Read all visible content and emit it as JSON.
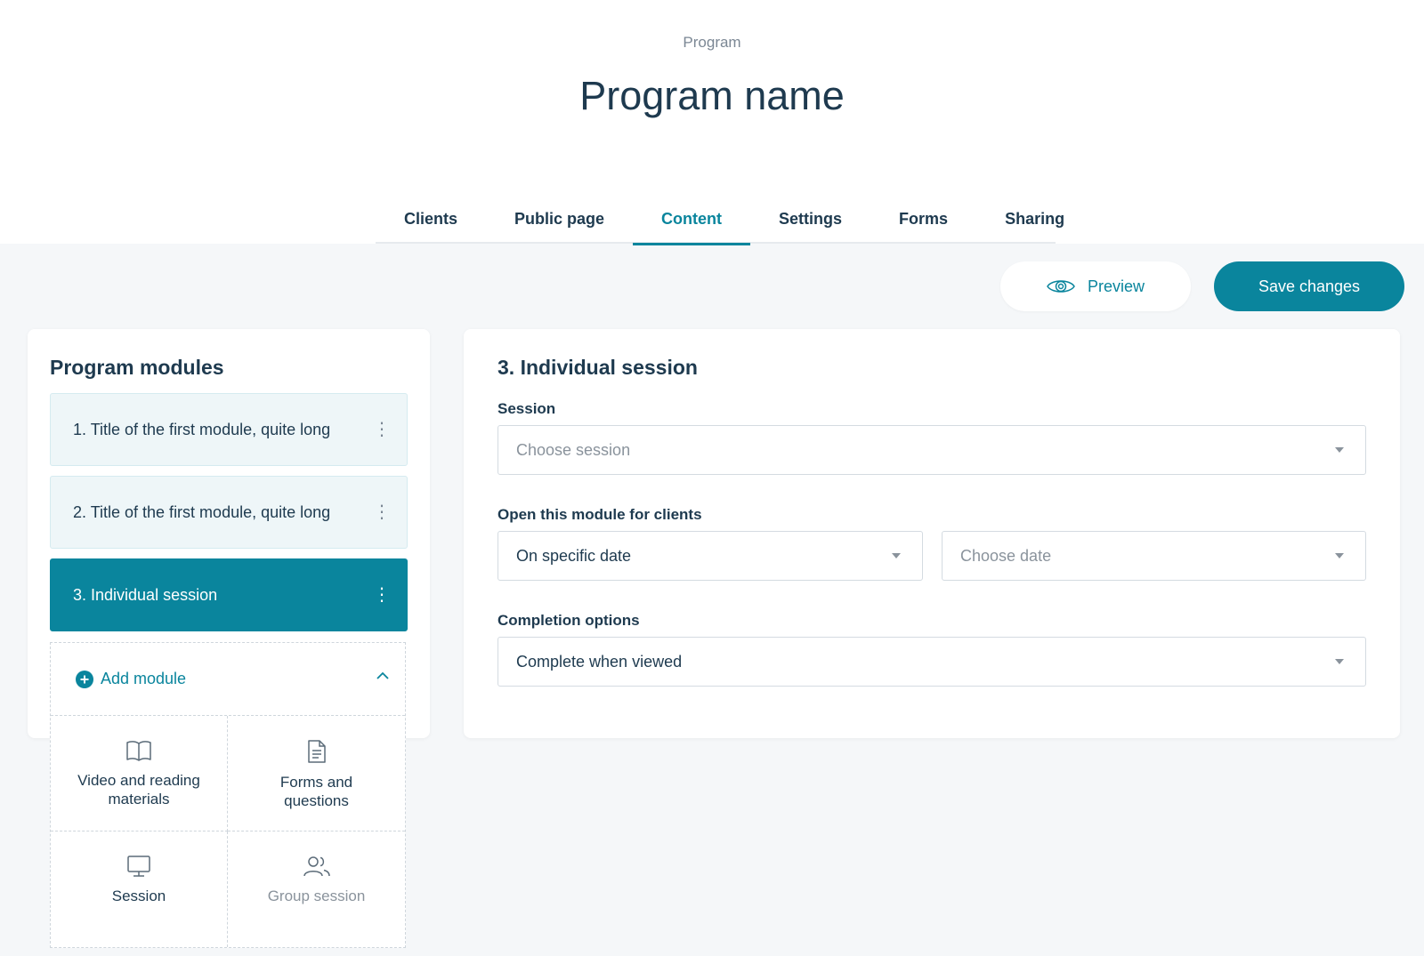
{
  "header": {
    "overline": "Program",
    "title": "Program name"
  },
  "tabs": [
    {
      "label": "Clients",
      "active": false
    },
    {
      "label": "Public page",
      "active": false
    },
    {
      "label": "Content",
      "active": true
    },
    {
      "label": "Settings",
      "active": false
    },
    {
      "label": "Forms",
      "active": false
    },
    {
      "label": "Sharing",
      "active": false
    }
  ],
  "toolbar": {
    "preview_label": "Preview",
    "save_label": "Save changes"
  },
  "modules_panel": {
    "title": "Program modules",
    "items": [
      {
        "label": "1. Title of the first module, quite long",
        "active": false
      },
      {
        "label": "2. Title of the first module, quite long",
        "active": false
      },
      {
        "label": "3. Individual session",
        "active": true
      }
    ],
    "add_module": {
      "label": "Add module",
      "options": [
        {
          "label": "Video and reading materials",
          "icon": "book-icon"
        },
        {
          "label": "Forms and questions",
          "icon": "document-icon"
        },
        {
          "label": "Session",
          "icon": "monitor-icon"
        },
        {
          "label": "Group session",
          "icon": "users-icon"
        }
      ]
    }
  },
  "detail": {
    "title": "3. Individual session",
    "session": {
      "label": "Session",
      "placeholder": "Choose session"
    },
    "open_for_clients": {
      "label": "Open this module for clients",
      "mode_value": "On specific date",
      "date_placeholder": "Choose date"
    },
    "completion": {
      "label": "Completion options",
      "value": "Complete when viewed"
    }
  },
  "colors": {
    "accent": "#0a859d",
    "text": "#1e3a4f",
    "muted": "#8a939c",
    "background": "#f5f7f9"
  }
}
